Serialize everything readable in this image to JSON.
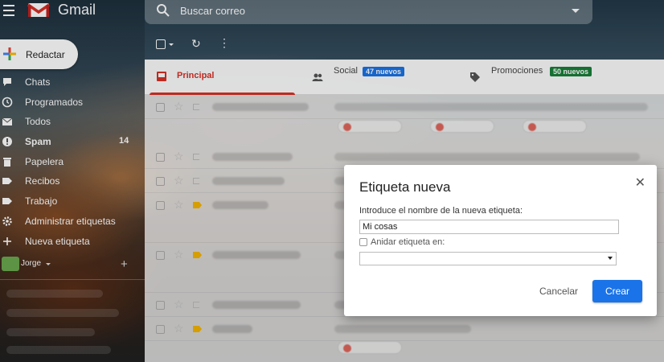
{
  "header": {
    "app_name": "Gmail",
    "search_placeholder": "Buscar correo"
  },
  "compose": {
    "label": "Redactar"
  },
  "sidebar": {
    "items": [
      {
        "label": "Chats",
        "icon": "chat-icon",
        "bold": false,
        "count": ""
      },
      {
        "label": "Programados",
        "icon": "schedule-icon",
        "bold": false,
        "count": ""
      },
      {
        "label": "Todos",
        "icon": "all-mail-icon",
        "bold": false,
        "count": ""
      },
      {
        "label": "Spam",
        "icon": "spam-icon",
        "bold": true,
        "count": "14"
      },
      {
        "label": "Papelera",
        "icon": "trash-icon",
        "bold": false,
        "count": ""
      },
      {
        "label": "Recibos",
        "icon": "label-icon",
        "bold": false,
        "count": ""
      },
      {
        "label": "Trabajo",
        "icon": "label-icon",
        "bold": false,
        "count": ""
      },
      {
        "label": "Administrar etiquetas",
        "icon": "gear-icon",
        "bold": false,
        "count": ""
      },
      {
        "label": "Nueva etiqueta",
        "icon": "plus-icon",
        "bold": false,
        "count": ""
      }
    ],
    "user": {
      "name": "Jorge"
    }
  },
  "tabs": [
    {
      "label": "Principal",
      "active": true
    },
    {
      "label": "Social",
      "badge": "47 nuevos",
      "badge_color": "#1a73e8"
    },
    {
      "label": "Promociones",
      "badge": "50 nuevos",
      "badge_color": "#188038"
    }
  ],
  "colors": {
    "accent_red": "#d93025",
    "button_blue": "#1a73e8",
    "important_yellow": "#f4b400"
  },
  "dialog": {
    "title": "Etiqueta nueva",
    "prompt": "Introduce el nombre de la nueva etiqueta:",
    "input_value": "Mi cosas",
    "nest_label": "Anidar etiqueta en:",
    "nest_checked": false,
    "select_value": "",
    "cancel_label": "Cancelar",
    "create_label": "Crear",
    "close_icon": "close-icon"
  }
}
